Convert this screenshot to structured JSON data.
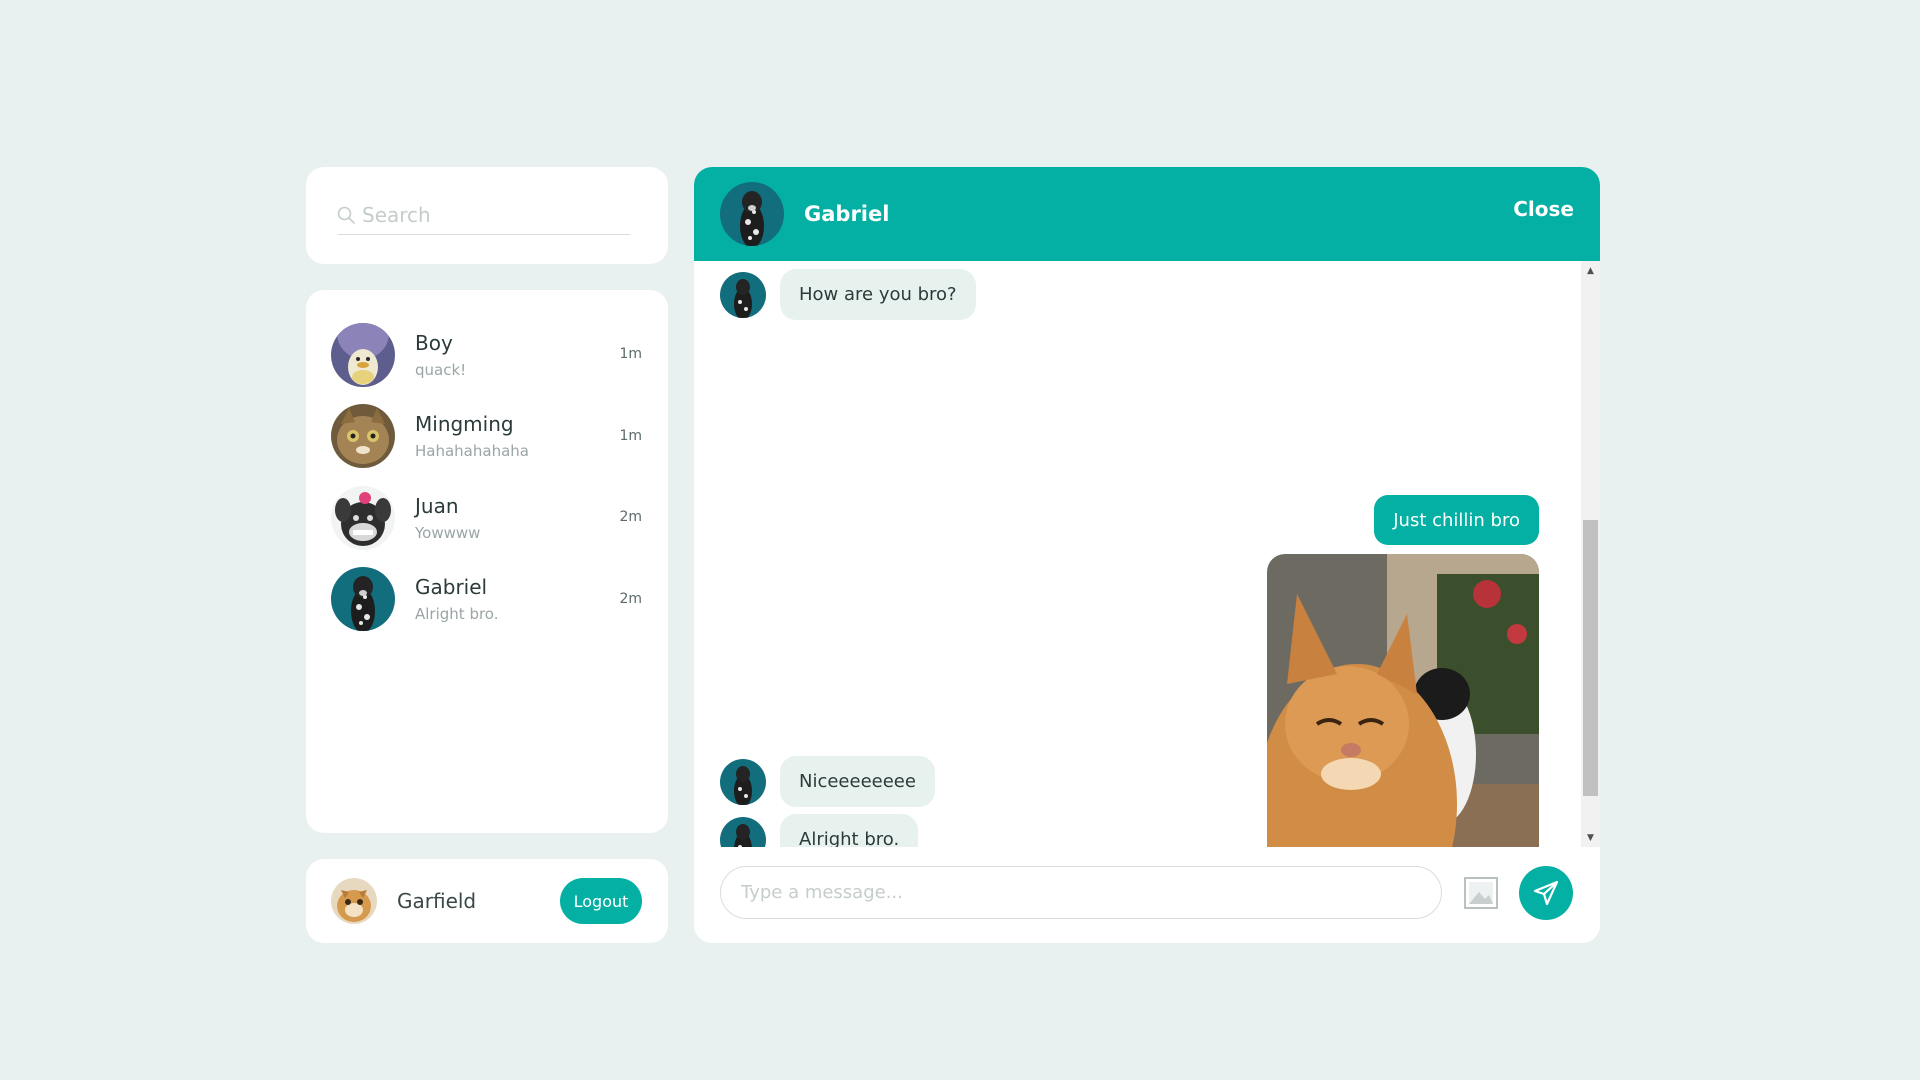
{
  "search": {
    "placeholder": "Search"
  },
  "contacts": [
    {
      "name": "Boy",
      "preview": "quack!",
      "time": "1m"
    },
    {
      "name": "Mingming",
      "preview": "Hahahahahaha",
      "time": "1m"
    },
    {
      "name": "Juan",
      "preview": "Yowwww",
      "time": "2m"
    },
    {
      "name": "Gabriel",
      "preview": "Alright bro.",
      "time": "2m"
    }
  ],
  "current_user": {
    "name": "Garfield",
    "logout_label": "Logout"
  },
  "chat": {
    "title": "Gabriel",
    "close_label": "Close",
    "messages": [
      {
        "direction": "in",
        "text": "How are you bro?"
      },
      {
        "direction": "out",
        "text": "Just chillin bro"
      },
      {
        "direction": "out",
        "type": "image",
        "icon": "cat-photo"
      },
      {
        "direction": "in",
        "text": "Niceeeeeeee"
      },
      {
        "direction": "in",
        "text": "Alright bro."
      }
    ],
    "composer_placeholder": "Type a message..."
  },
  "colors": {
    "accent": "#04b0a3",
    "background": "#e8f1ef",
    "incoming_bubble": "#e7f2ef",
    "card": "#ffffff"
  }
}
